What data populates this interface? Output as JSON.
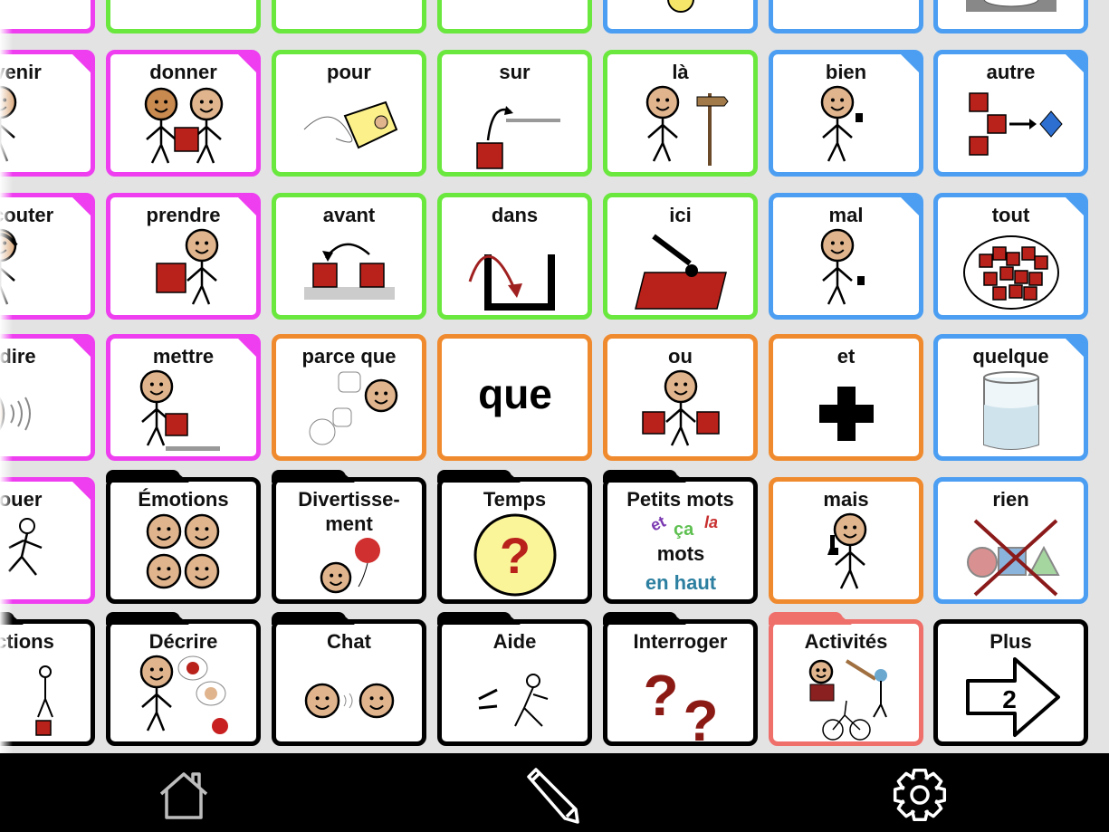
{
  "colors": {
    "social": "#ee3ef0",
    "verb": "#ee3ef0",
    "preposition": "#6ae83e",
    "adjective": "#4b9ef2",
    "conjunction": "#f08a2e",
    "folder": "#000000",
    "activities": "#ef6f6b",
    "background": "#e3e3e3",
    "toolbar": "#000000"
  },
  "rows": [
    [
      {
        "label": "",
        "color": "#ee3ef0",
        "corner": true,
        "icon": "partial"
      },
      {
        "label": "",
        "color": "#6ae83e",
        "icon": "partial"
      },
      {
        "label": "",
        "color": "#6ae83e",
        "icon": "red-square"
      },
      {
        "label": "",
        "color": "#6ae83e",
        "icon": "partial"
      },
      {
        "label": "",
        "color": "#4b9ef2",
        "icon": "clock"
      },
      {
        "label": "",
        "color": "#4b9ef2",
        "icon": "partial"
      },
      {
        "label": "",
        "color": "#4b9ef2",
        "icon": "plate"
      }
    ],
    [
      {
        "label": "venir",
        "color": "#ee3ef0",
        "corner": true,
        "icon": "person-wave"
      },
      {
        "label": "donner",
        "color": "#ee3ef0",
        "corner": true,
        "icon": "two-people-box"
      },
      {
        "label": "pour",
        "color": "#6ae83e",
        "icon": "tag"
      },
      {
        "label": "sur",
        "color": "#6ae83e",
        "icon": "on-arrow"
      },
      {
        "label": "là",
        "color": "#6ae83e",
        "icon": "person-signpost"
      },
      {
        "label": "bien",
        "color": "#4b9ef2",
        "corner": true,
        "icon": "person-thumb-up"
      },
      {
        "label": "autre",
        "color": "#4b9ef2",
        "corner": true,
        "icon": "squares-diamond"
      }
    ],
    [
      {
        "label": "écouter",
        "color": "#ee3ef0",
        "corner": true,
        "icon": "person-headphones"
      },
      {
        "label": "prendre",
        "color": "#ee3ef0",
        "corner": true,
        "icon": "person-box"
      },
      {
        "label": "avant",
        "color": "#6ae83e",
        "icon": "before-boxes"
      },
      {
        "label": "dans",
        "color": "#6ae83e",
        "icon": "in-container"
      },
      {
        "label": "ici",
        "color": "#6ae83e",
        "icon": "point-here"
      },
      {
        "label": "mal",
        "color": "#4b9ef2",
        "corner": true,
        "icon": "person-thumb-down"
      },
      {
        "label": "tout",
        "color": "#4b9ef2",
        "corner": true,
        "icon": "many-squares"
      }
    ],
    [
      {
        "label": "dire",
        "color": "#ee3ef0",
        "corner": true,
        "icon": "face-speak"
      },
      {
        "label": "mettre",
        "color": "#ee3ef0",
        "corner": true,
        "icon": "person-put"
      },
      {
        "label": "parce que",
        "color": "#f08a2e",
        "icon": "because-bubbles"
      },
      {
        "label": "",
        "color": "#f08a2e",
        "icon": "text",
        "text": "que"
      },
      {
        "label": "ou",
        "color": "#f08a2e",
        "icon": "person-two-boxes"
      },
      {
        "label": "et",
        "color": "#f08a2e",
        "icon": "plus"
      },
      {
        "label": "quelque",
        "color": "#4b9ef2",
        "corner": true,
        "icon": "glass"
      }
    ],
    [
      {
        "label": "jouer",
        "color": "#ee3ef0",
        "corner": true,
        "icon": "people-running"
      },
      {
        "label": "Émotions",
        "color": "#000000",
        "folder": true,
        "icon": "four-faces"
      },
      {
        "label": "Divertisse-ment",
        "color": "#000000",
        "folder": true,
        "two": true,
        "icon": "face-balloon"
      },
      {
        "label": "Temps",
        "color": "#000000",
        "folder": true,
        "icon": "clock-question"
      },
      {
        "label": "Petits mots",
        "color": "#000000",
        "folder": true,
        "icon": "small-words",
        "words": [
          "et",
          "ça",
          "la",
          "mots",
          "en haut"
        ]
      },
      {
        "label": "mais",
        "color": "#f08a2e",
        "icon": "person-finger"
      },
      {
        "label": "rien",
        "color": "#4b9ef2",
        "icon": "nothing-shapes"
      }
    ],
    [
      {
        "label": "Actions",
        "color": "#000000",
        "folder": true,
        "icon": "actions"
      },
      {
        "label": "Décrire",
        "color": "#000000",
        "folder": true,
        "icon": "person-describe"
      },
      {
        "label": "Chat",
        "color": "#000000",
        "folder": true,
        "icon": "two-faces"
      },
      {
        "label": "Aide",
        "color": "#000000",
        "folder": true,
        "icon": "help"
      },
      {
        "label": "Interroger",
        "color": "#000000",
        "folder": true,
        "icon": "question-marks"
      },
      {
        "label": "Activités",
        "color": "#ef6f6b",
        "folder": true,
        "icon": "activities"
      },
      {
        "label": "Plus",
        "color": "#000000",
        "icon": "next-page",
        "text": "2"
      }
    ]
  ],
  "toolbar": {
    "home": "home-icon",
    "edit": "pencil-icon",
    "settings": "gear-icon"
  }
}
